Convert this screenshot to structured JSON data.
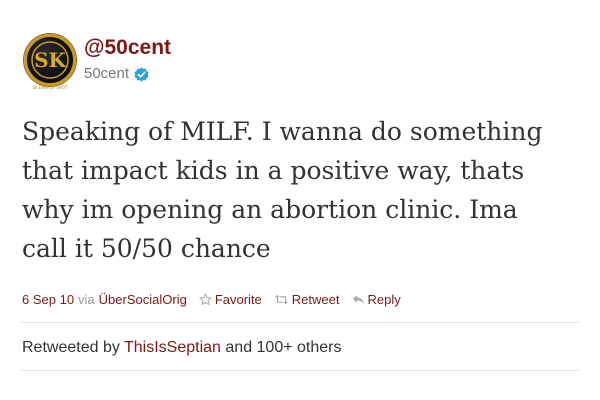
{
  "author": {
    "display_name": "@50cent",
    "handle": "50cent",
    "avatar_text": "SK",
    "avatar_caption": "SK ENERGY SHOT",
    "verified_icon": "verified-badge-icon"
  },
  "tweet": {
    "lines": [
      "Speaking of MILF. I wanna do something",
      "that impact kids in a positive way, thats",
      "why im opening an abortion clinic. Ima",
      "call it 50/50 chance"
    ]
  },
  "meta": {
    "date": "6 Sep 10",
    "via_label": "via",
    "source": "ÜberSocialOrig",
    "favorite_label": "Favorite",
    "retweet_label": "Retweet",
    "reply_label": "Reply"
  },
  "retweeted": {
    "prefix": "Retweeted by",
    "user": "ThisIsSeptian",
    "suffix": "and 100+ others"
  },
  "colors": {
    "accent": "#7a1a14",
    "text": "#333333",
    "muted": "#999999",
    "verified": "#2b9fe0",
    "avatar_ring": "#c89a2a"
  }
}
